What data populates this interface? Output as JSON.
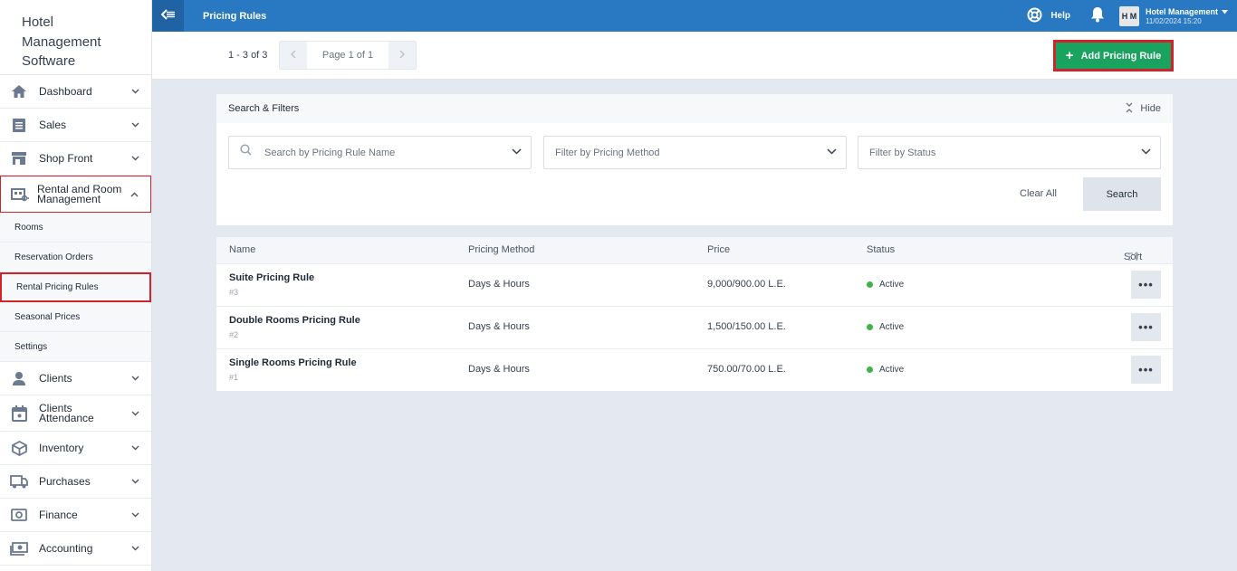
{
  "brand": {
    "line1": "Hotel",
    "line2": "Management",
    "line3": "Software"
  },
  "sidebar": {
    "items": [
      {
        "label": "Dashboard",
        "icon": "home-icon"
      },
      {
        "label": "Sales",
        "icon": "sales-icon"
      },
      {
        "label": "Shop Front",
        "icon": "shop-icon"
      },
      {
        "label": "Rental and Room Management",
        "icon": "rental-icon"
      },
      {
        "label": "Clients",
        "icon": "clients-icon"
      },
      {
        "label": "Clients Attendance",
        "icon": "calendar-icon"
      },
      {
        "label": "Inventory",
        "icon": "box-icon"
      },
      {
        "label": "Purchases",
        "icon": "truck-icon"
      },
      {
        "label": "Finance",
        "icon": "safe-icon"
      },
      {
        "label": "Accounting",
        "icon": "money-icon"
      }
    ],
    "sub_items": [
      "Rooms",
      "Reservation Orders",
      "Rental Pricing Rules",
      "Seasonal Prices",
      "Settings"
    ]
  },
  "topbar": {
    "title": "Pricing Rules",
    "help": "Help",
    "avatar": "H M",
    "user_name": "Hotel Management",
    "user_datetime": "11/02/2024 15:20"
  },
  "toolbar": {
    "count": "1 - 3 of 3",
    "page": "Page 1 of 1",
    "add_label": "Add Pricing Rule"
  },
  "filters": {
    "title": "Search & Filters",
    "hide": "Hide",
    "search_placeholder": "Search by Pricing Rule Name",
    "method_placeholder": "Filter by Pricing Method",
    "status_placeholder": "Filter by Status",
    "clear": "Clear All",
    "search": "Search"
  },
  "table": {
    "headers": {
      "name": "Name",
      "method": "Pricing Method",
      "price": "Price",
      "status": "Status",
      "sort": "Sort"
    },
    "rows": [
      {
        "name": "Suite Pricing Rule",
        "id": "#3",
        "method": "Days & Hours",
        "price": "9,000/900.00 L.E.",
        "status": "Active"
      },
      {
        "name": "Double Rooms Pricing Rule",
        "id": "#2",
        "method": "Days & Hours",
        "price": "1,500/150.00 L.E.",
        "status": "Active"
      },
      {
        "name": "Single Rooms Pricing Rule",
        "id": "#1",
        "method": "Days & Hours",
        "price": "750.00/70.00 L.E.",
        "status": "Active"
      }
    ],
    "more": "•••"
  },
  "colors": {
    "topbar": "#2878c2",
    "add_button": "#19a35f",
    "highlight": "#d1232a",
    "active_dot": "#3fb24a"
  }
}
